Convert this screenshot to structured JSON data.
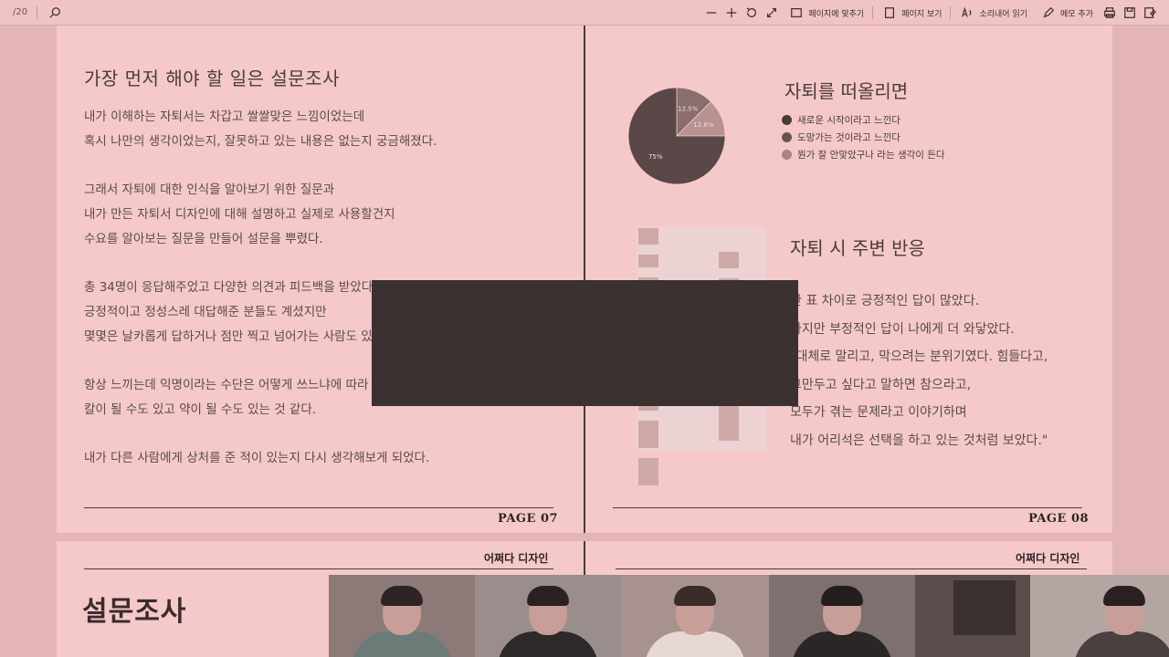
{
  "toolbar": {
    "page_indicator": "/20",
    "fit_page": "페이지에 맞추기",
    "page_view": "페이지 보기",
    "read_aloud": "소리내어 읽기",
    "add_note": "메모 추가"
  },
  "left_page": {
    "heading": "가장 먼저 해야 할 일은 설문조사",
    "paragraphs": [
      [
        "내가 이해하는 자퇴서는 차갑고 쌀쌀맞은 느낌이었는데",
        "혹시 나만의 생각이었는지, 잘못하고 있는 내용은 없는지 궁금해졌다."
      ],
      [
        "그래서 자퇴에 대한 인식을 알아보기 위한 질문과",
        "내가 만든 자퇴서 디자인에 대해 설명하고 실제로 사용할건지",
        "수요를 알아보는 질문을 만들어 설문을 뿌렸다."
      ],
      [
        "총 34명이 응답해주었고 다양한 의견과 피드백을 받았다.",
        "긍정적이고 정성스레 대답해준 분들도 계셨지만",
        "몇몇은 날카롭게 답하거나 점만 찍고 넘어가는 사람도 있었다."
      ],
      [
        "항상 느끼는데 익명이라는 수단은 어떻게 쓰느냐에 따라",
        "칼이 될 수도 있고 약이 될 수도 있는 것 같다."
      ],
      [
        "내가 다른 사람에게 상처를 준 적이 있는지 다시 생각해보게 되었다."
      ]
    ],
    "page_label": "PAGE 07"
  },
  "right_page": {
    "pie_title": "자퇴를 떠올리면",
    "legend": [
      {
        "label": "새로운 시작이라고 느낀다",
        "color": "#4a3b3b"
      },
      {
        "label": "도망가는 것이라고 느낀다",
        "color": "#6b5252"
      },
      {
        "label": "뭔가 잘 안맞았구나 라는 생각이 든다",
        "color": "#a88484"
      }
    ],
    "heading2": "자퇴 시 주변 반응",
    "lines": [
      "한 표 차이로 긍정적인 답이 많았다.",
      "하지만 부정적인 답이 나에게 더 와닿았다.",
      "\"대체로 말리고, 막으려는 분위기였다. 힘들다고,",
      "그만두고 싶다고 말하면 참으라고,",
      "모두가 겪는 문제라고 이야기하며",
      "내가 어리석은 선택을 하고 있는 것처럼 보았다.\""
    ],
    "page_label": "PAGE 08"
  },
  "chart_data": {
    "type": "pie",
    "title": "자퇴를 떠올리면",
    "categories": [
      "새로운 시작이라고 느낀다",
      "도망가는 것이라고 느낀다",
      "뭔가 잘 안맞았구나 라는 생각이 든다"
    ],
    "values": [
      75,
      12.5,
      12.5
    ],
    "data_labels": [
      "75%",
      "12.5%",
      "12.6%"
    ],
    "colors": [
      "#5a4747",
      "#8a6e6e",
      "#b89292"
    ]
  },
  "bottom": {
    "brand_left": "어쩌다 디자인",
    "brand_right": "어쩌다 디자인",
    "title": "설문조사"
  },
  "video": {
    "tiles": [
      {
        "bg": "#8c7a79",
        "shirt": "#6b7c78",
        "hair": "#2e2424"
      },
      {
        "bg": "#9a8e8c",
        "shirt": "#2e2929",
        "hair": "#2a2222"
      },
      {
        "bg": "#a8928f",
        "shirt": "#e8d8d4",
        "hair": "#3a2c28"
      },
      {
        "bg": "#7d706e",
        "shirt": "#2b2626",
        "hair": "#241d1d"
      },
      {
        "bg": "#5a4c4b",
        "shirt": "#3a3232",
        "hair": "#201a1a"
      },
      {
        "bg": "#b4a4a2",
        "shirt": "#4a4040",
        "hair": "#2a2020"
      }
    ]
  }
}
